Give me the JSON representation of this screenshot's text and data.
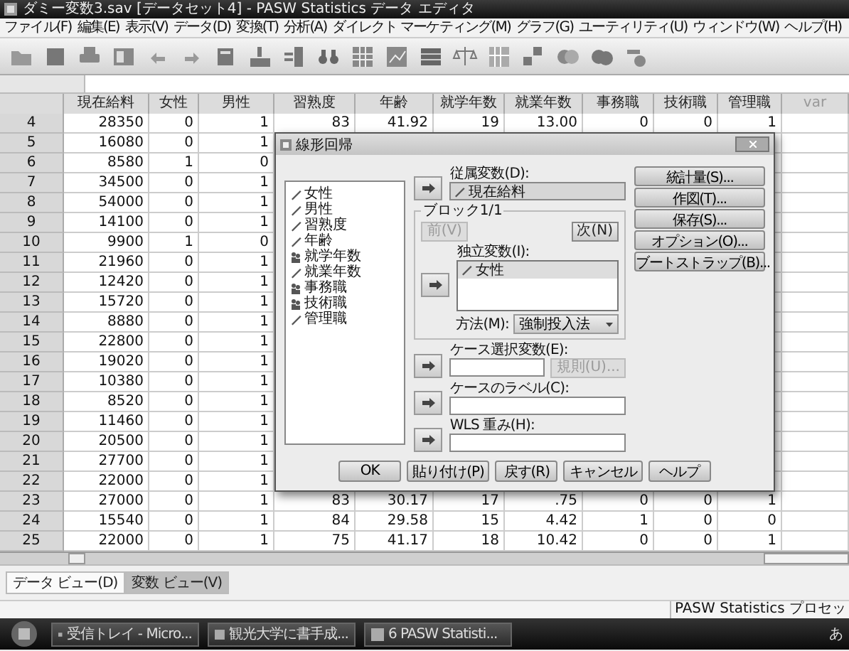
{
  "window": {
    "title": "ダミー変数3.sav [データセット4] - PASW Statistics データ エディタ"
  },
  "menu": [
    "ファイル(F)",
    "編集(E)",
    "表示(V)",
    "データ(D)",
    "変換(T)",
    "分析(A)",
    "ダイレクト マーケティング(M)",
    "グラフ(G)",
    "ユーティリティ(U)",
    "ウィンドウ(W)",
    "ヘルプ(H)"
  ],
  "table": {
    "columns": [
      "現在給料",
      "女性",
      "男性",
      "習熟度",
      "年齢",
      "就学年数",
      "就業年数",
      "事務職",
      "技術職",
      "管理職",
      "var"
    ],
    "rows": [
      {
        "row": "4",
        "cells": [
          "28350",
          "0",
          "1",
          "83",
          "41.92",
          "19",
          "13.00",
          "0",
          "0",
          "1"
        ]
      },
      {
        "row": "5",
        "cells": [
          "16080",
          "0",
          "1"
        ]
      },
      {
        "row": "6",
        "cells": [
          "8580",
          "1",
          "0"
        ]
      },
      {
        "row": "7",
        "cells": [
          "34500",
          "0",
          "1"
        ]
      },
      {
        "row": "8",
        "cells": [
          "54000",
          "0",
          "1"
        ]
      },
      {
        "row": "9",
        "cells": [
          "14100",
          "0",
          "1"
        ]
      },
      {
        "row": "10",
        "cells": [
          "9900",
          "1",
          "0"
        ]
      },
      {
        "row": "11",
        "cells": [
          "21960",
          "0",
          "1"
        ]
      },
      {
        "row": "12",
        "cells": [
          "12420",
          "0",
          "1"
        ]
      },
      {
        "row": "13",
        "cells": [
          "15720",
          "0",
          "1"
        ]
      },
      {
        "row": "14",
        "cells": [
          "8880",
          "0",
          "1"
        ]
      },
      {
        "row": "15",
        "cells": [
          "22800",
          "0",
          "1"
        ]
      },
      {
        "row": "16",
        "cells": [
          "19020",
          "0",
          "1"
        ]
      },
      {
        "row": "17",
        "cells": [
          "10380",
          "0",
          "1"
        ]
      },
      {
        "row": "18",
        "cells": [
          "8520",
          "0",
          "1"
        ]
      },
      {
        "row": "19",
        "cells": [
          "11460",
          "0",
          "1"
        ]
      },
      {
        "row": "20",
        "cells": [
          "20500",
          "0",
          "1"
        ]
      },
      {
        "row": "21",
        "cells": [
          "27700",
          "0",
          "1"
        ]
      },
      {
        "row": "22",
        "cells": [
          "22000",
          "0",
          "1"
        ]
      },
      {
        "row": "23",
        "cells": [
          "27000",
          "0",
          "1",
          "83",
          "30.17",
          "17",
          ".75",
          "0",
          "0",
          "1"
        ]
      },
      {
        "row": "24",
        "cells": [
          "15540",
          "0",
          "1",
          "84",
          "29.58",
          "15",
          "4.42",
          "1",
          "0",
          "0"
        ]
      },
      {
        "row": "25",
        "cells": [
          "22000",
          "0",
          "1",
          "75",
          "41.17",
          "18",
          "10.42",
          "0",
          "0",
          "1"
        ]
      }
    ]
  },
  "dialog": {
    "title": "線形回帰",
    "variables": [
      {
        "name": "女性",
        "kind": "scale"
      },
      {
        "name": "男性",
        "kind": "scale"
      },
      {
        "name": "習熟度",
        "kind": "scale"
      },
      {
        "name": "年齢",
        "kind": "scale"
      },
      {
        "name": "就学年数",
        "kind": "nominal"
      },
      {
        "name": "就業年数",
        "kind": "scale"
      },
      {
        "name": "事務職",
        "kind": "nominal"
      },
      {
        "name": "技術職",
        "kind": "nominal"
      },
      {
        "name": "管理職",
        "kind": "scale"
      }
    ],
    "dependent": {
      "label": "従属変数(D):",
      "value": "現在給料"
    },
    "block": {
      "label": "ブロック1/1",
      "buttons": [
        {
          "label": "前(V)",
          "disabled": true
        },
        {
          "label": "次(N)",
          "disabled": false
        }
      ]
    },
    "independent": {
      "label": "独立変数(I):",
      "items": [
        "女性"
      ]
    },
    "method": {
      "label": "方法(M):",
      "value": "強制投入法"
    },
    "selection": {
      "label": "ケース選択変数(E):",
      "button": {
        "label": "規則(U)...",
        "disabled": true
      }
    },
    "case_label": {
      "label": "ケースのラベル(C):"
    },
    "wls": {
      "label": "WLS 重み(H):"
    },
    "side_buttons": [
      "統計量(S)...",
      "作図(T)...",
      "保存(S)...",
      "オプション(O)...",
      "ブートストラップ(B)..."
    ],
    "bottom_buttons": [
      "OK",
      "貼り付け(P)",
      "戻す(R)",
      "キャンセル",
      "ヘルプ"
    ]
  },
  "tabs": [
    {
      "label": "データ ビュー(D)",
      "selected": true
    },
    {
      "label": "変数 ビュー(V)",
      "selected": false
    }
  ],
  "status_bar": {
    "text": "PASW Statistics プロセッ"
  },
  "taskbar": {
    "items": [
      "受信トレイ - Micro...",
      "観光大学に書手成...",
      "6 PASW Statisti..."
    ],
    "tray": "あ"
  }
}
